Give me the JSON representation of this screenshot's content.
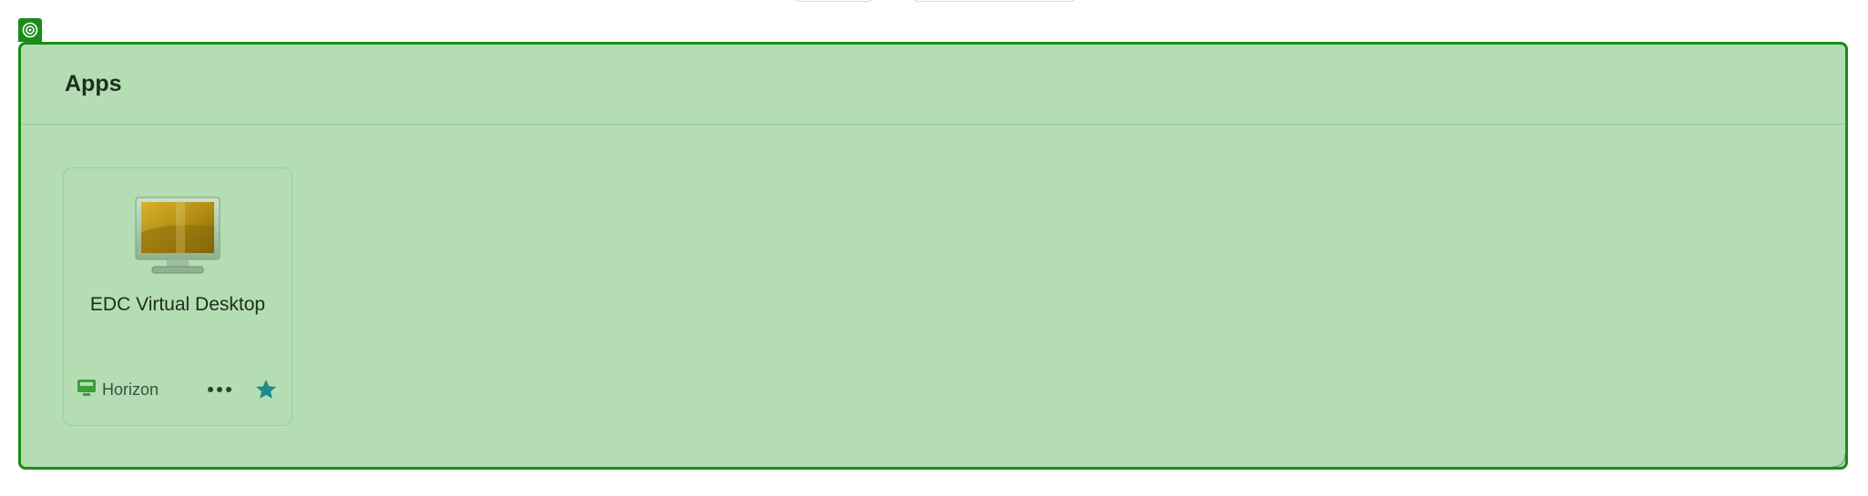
{
  "section": {
    "title": "Apps"
  },
  "apps": [
    {
      "name": "EDC Virtual Desktop",
      "source_label": "Horizon",
      "icon": "monitor-desktop-icon",
      "favorite": true
    }
  ],
  "colors": {
    "highlight_border": "#1a8c1a",
    "highlight_fill": "#b4ddb4",
    "favorite_star": "#1e8a8a",
    "horizon_icon": "#3aa03a"
  }
}
